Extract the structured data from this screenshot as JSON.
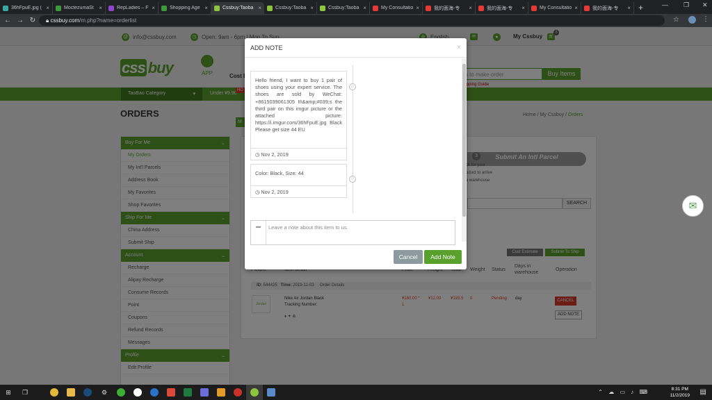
{
  "browser": {
    "tabs": [
      {
        "title": "36hFpuE.jpg (",
        "icon": "image-tab-icon",
        "color": "#3aa7a0"
      },
      {
        "title": "MoctezumaSt",
        "icon": "site-tab-icon",
        "color": "#3d9a3a"
      },
      {
        "title": "RepLadies – F",
        "icon": "replady-tab-icon",
        "color": "#8b46c9"
      },
      {
        "title": "Shopping Age",
        "icon": "site-tab-icon",
        "color": "#3d9a3a"
      },
      {
        "title": "Cssbuy:Taoba",
        "icon": "cssbuy-tab-icon",
        "color": "#8cc63f",
        "active": true
      },
      {
        "title": "Cssbuy:Taoba",
        "icon": "cssbuy-tab-icon",
        "color": "#8cc63f"
      },
      {
        "title": "Cssbuy:Taoba",
        "icon": "cssbuy-tab-icon",
        "color": "#8cc63f"
      },
      {
        "title": "My Consultatio",
        "icon": "weidian-tab-icon",
        "color": "#e53935"
      },
      {
        "title": "我的面海-专",
        "icon": "weidian-tab-icon",
        "color": "#e53935"
      },
      {
        "title": "我的面海-专",
        "icon": "weidian-tab-icon",
        "color": "#e53935"
      },
      {
        "title": "My Consultatio",
        "icon": "s-tab-icon",
        "color": "#e53935"
      },
      {
        "title": "我的面海-专",
        "icon": "s-tab-icon",
        "color": "#e53935"
      }
    ],
    "new_tab": "+",
    "url_host": "cssbuy.com",
    "url_path": "/m.php?name=orderlist"
  },
  "site": {
    "email": "info@cssbuy.com",
    "hours": "Open: 9am - 6pm | Mon To Sun",
    "language": "English",
    "my_cssbuy": "My Cssbuy",
    "cart_count": "0",
    "logo": "buy",
    "app_label": "APP",
    "cost_label": "Cost E",
    "search_placeholder": "s to make order",
    "buy_items": "Buy Items",
    "shopping_guide": "hopping Guide",
    "taobao_category": "TaoBao Category",
    "under_label": "Under ¥9.90",
    "hot": "HO"
  },
  "main": {
    "title": "ORDERS",
    "breadcrumb": {
      "home": "Home",
      "sep": "/",
      "my": "My Cssbuy",
      "current": "Orders"
    },
    "intl_title": "Submit An Intl Parcel",
    "intl_num": "3",
    "intl_text_1": "ck for your",
    "intl_text_2": "oduct to arrive",
    "intl_text_3": "e warehouse",
    "search_btn": "SEARCH",
    "cost_estimate": "Cost Estimate",
    "submit_to_ship": "Submit To Ship",
    "headers": {
      "picture": "Picture",
      "item_detail": "Item detail",
      "price": "Price",
      "freight": "Freight",
      "total": "Total",
      "weight": "Weight",
      "status": "Status",
      "days": "Days in warehouse",
      "operation": "Operation"
    },
    "order": {
      "id_label": "ID:",
      "id": "544425",
      "time_label": "Time:",
      "time": "2019-11-03",
      "details": "Order Details"
    },
    "item": {
      "name": "Nike Air Jordan Black",
      "tracking": "Tracking Number:",
      "price": "¥180.00 *",
      "qty": "1",
      "freight": "¥12.00",
      "total": "¥193.5",
      "weight": "0",
      "status": "Pending",
      "days": "day",
      "cancel": "CANCEL",
      "add_note": "ADD NOTE"
    }
  },
  "sidebar": {
    "sections": [
      {
        "title": "Buy For Me",
        "items": [
          "My Orders",
          "My Int'l Parcels",
          "Address Book",
          "My Favorites",
          "Shop Favorites"
        ]
      },
      {
        "title": "Ship For Me",
        "items": [
          "China Address",
          "Submit Ship"
        ]
      },
      {
        "title": "Account",
        "items": [
          "Recharge",
          "Alipay Recharge",
          "Consume Records",
          "Point",
          "Coupons",
          "Refund Records",
          "Messages"
        ]
      },
      {
        "title": "Profile",
        "items": [
          "Edit Profile"
        ]
      }
    ]
  },
  "modal": {
    "title": "ADD NOTE",
    "close": "×",
    "notes": [
      {
        "text": "Hello friend, I want to buy 1 pair of shoes using your expert service. The shoes are sold by WeChat: +8615039061305 It\\&amp;#039;s the third pair on this imgur picture or the attached picture: https://i.imgur.com/36hFpuE.jpg Black Please get size 44 EU",
        "date": "Nov 2, 2019"
      },
      {
        "text": "Color: Black, Size: 44",
        "date": "Nov 2, 2019"
      }
    ],
    "placeholder": "Leave a note about this item to us.",
    "cancel": "Cancel",
    "add": "Add Note"
  },
  "taskbar": {
    "time": "8:31 PM",
    "date": "11/2/2019"
  }
}
